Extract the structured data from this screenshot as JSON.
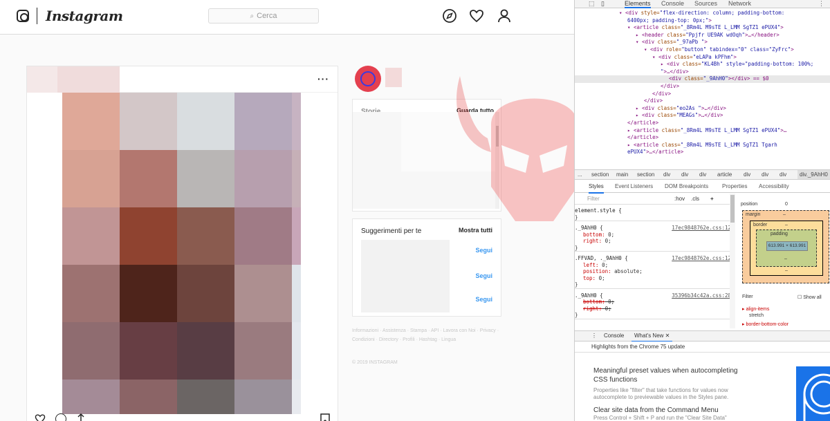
{
  "instagram": {
    "brand": "Instagram",
    "search_placeholder": "Cerca",
    "icons": [
      "instagram-logo-icon",
      "compass-icon",
      "heart-icon",
      "profile-icon",
      "more-icon",
      "like-icon",
      "comment-icon",
      "share-icon",
      "bookmark-icon"
    ],
    "sidebar": {
      "stories_title": "Storie",
      "stories_link": "Guarda tutto",
      "suggestions_title": "Suggerimenti per te",
      "suggestions_link": "Mostra tutti",
      "follow_labels": [
        "Segui",
        "Segui",
        "Segui"
      ]
    },
    "footer": {
      "links": "Informazioni · Assistenza · Stampa · API · Lavora con Noi · Privacy · Condizioni · Directory · Profili · Hashtag · Lingua",
      "copyright": "© 2019 INSTAGRAM"
    },
    "mosaic_colors": [
      "#dfa898",
      "#d3c7c8",
      "#d9dde0",
      "#b6a9bc",
      "#c7b3c2",
      "#d7a293",
      "#b3776f",
      "#b9b6b5",
      "#b79fae",
      "#c6b0b7",
      "#c19595",
      "#8f4330",
      "#8a5b4f",
      "#a07b86",
      "#c8a6b8",
      "#9d7271",
      "#4e241b",
      "#6d443d",
      "#ad8f90",
      "#dfe4ea",
      "#8f6c70",
      "#673e44",
      "#583d44",
      "#9a7b7f",
      "#e4e8ee",
      "#a48b97",
      "#8b6466",
      "#6b6564",
      "#9a919b",
      "#e8eaef"
    ],
    "accent_colors": {
      "avatar": "#e4404f",
      "follow": "#3897f0"
    }
  },
  "devtools": {
    "tabs": [
      "Elements",
      "Console",
      "Sources",
      "Network"
    ],
    "dom_lines": [
      {
        "indent": 64,
        "tag": "▾ <div ",
        "attr": "style",
        "val": "\"flex-direction: column; padding-bottom:",
        "rest": ""
      },
      {
        "indent": 76,
        "tag": "",
        "attr": "",
        "val": "6400px; padding-top: 0px;\"",
        "rest": ">"
      },
      {
        "indent": 76,
        "tag": "▾ <article ",
        "attr": "class",
        "val": "\"_8Rm4L M9sTE  L_LMM SgTZ1   ePUX4\"",
        "rest": ">"
      },
      {
        "indent": 88,
        "tag": "▸ <header ",
        "attr": "class",
        "val": "\"Ppjfr UE9AK  wdOqh\"",
        "rest": ">…</header>"
      },
      {
        "indent": 88,
        "tag": "▾ <div ",
        "attr": "class",
        "val": "\"_97aPb \"",
        "rest": ">"
      },
      {
        "indent": 100,
        "tag": "▾ <div ",
        "attr": "role",
        "val": "\"button\" tabindex=\"0\" class=\"ZyFrc\"",
        "rest": ">"
      },
      {
        "indent": 112,
        "tag": "▾ <div ",
        "attr": "class",
        "val": "\"eLAPa kPFhm\"",
        "rest": ">"
      },
      {
        "indent": 124,
        "tag": "▸ <div ",
        "attr": "class",
        "val": "\"KL4Bh\" style=\"padding-bottom: 100%;",
        "rest": ""
      },
      {
        "indent": 124,
        "tag": "",
        "attr": "",
        "val": "\"",
        "rest": ">…</div>"
      },
      {
        "indent": 136,
        "tag": "<div ",
        "attr": "class",
        "val": "\"_9AhH0\"",
        "rest": "></div> == $0"
      },
      {
        "indent": 124,
        "tag": "</div>",
        "attr": "",
        "val": "",
        "rest": ""
      },
      {
        "indent": 112,
        "tag": "</div>",
        "attr": "",
        "val": "",
        "rest": ""
      },
      {
        "indent": 100,
        "tag": "</div>",
        "attr": "",
        "val": "",
        "rest": ""
      },
      {
        "indent": 88,
        "tag": "▸ <div ",
        "attr": "class",
        "val": "\"eo2As \"",
        "rest": ">…</div>"
      },
      {
        "indent": 88,
        "tag": "▸ <div ",
        "attr": "class",
        "val": "\"MEAGs\"",
        "rest": ">…</div>"
      },
      {
        "indent": 76,
        "tag": "</article>",
        "attr": "",
        "val": "",
        "rest": ""
      },
      {
        "indent": 76,
        "tag": "▸ <article ",
        "attr": "class",
        "val": "\"_8Rm4L M9sTE  L_LMM SgTZ1   ePUX4\"",
        "rest": ">…"
      },
      {
        "indent": 76,
        "tag": "</article>",
        "attr": "",
        "val": "",
        "rest": ""
      },
      {
        "indent": 76,
        "tag": "▸ <article ",
        "attr": "class",
        "val": "\"_8Rm4L M9sTE  L_LMM SgTZ1   Tgarh",
        "rest": ""
      },
      {
        "indent": 76,
        "tag": "",
        "attr": "",
        "val": "ePUX4\"",
        "rest": ">…</article>"
      }
    ],
    "selected_dom_index": 9,
    "breadcrumbs": [
      "...",
      "section",
      "main",
      "section",
      "div",
      "div",
      "div",
      "article",
      "div",
      "div",
      "div",
      "div._9AhH0"
    ],
    "sub_tabs": [
      "Styles",
      "Event Listeners",
      "DOM Breakpoints",
      "Properties",
      "Accessibility"
    ],
    "styles_filter_placeholder": "Filter",
    "styles_filter_buttons": [
      ":hov",
      ".cls",
      "+"
    ],
    "style_rules": [
      {
        "selector": "element.style {",
        "source": "",
        "props": [
          "}"
        ]
      },
      {
        "selector": "._9AhH0 {",
        "source": "17ec9848762e.css:12",
        "props": [
          "bottom: 0;",
          "right: 0;",
          "}"
        ]
      },
      {
        "selector": ".FFVAD, ._9AhH0 {",
        "source": "17ec9848762e.css:12",
        "props": [
          "left: 0;",
          "position: absolute;",
          "top: 0;",
          "}"
        ]
      },
      {
        "selector": "._9AhH0 {",
        "source": "35396b34c42a.css:28",
        "props": [
          "bottom: 0;",
          "right: 0;",
          "}"
        ]
      }
    ],
    "box_model": {
      "position_label": "position",
      "position_value": "0",
      "margin_label": "margin",
      "border_label": "border",
      "padding_label": "padding",
      "content": "613.991 × 613.991",
      "dash": "–"
    },
    "computed_filter": "Filter",
    "show_all": "Show all",
    "computed_props": [
      "align-items",
      "stretch",
      "border-bottom-color"
    ],
    "console_tabs": [
      "Console",
      "What's New ✕"
    ],
    "whatsnew_header": "Highlights from the Chrome 75 update",
    "whatsnew_items": [
      {
        "title": "Meaningful preset values when autocompleting CSS functions",
        "desc": "Properties like \"filter\" that take functions for values now autocomplete to previewable values in the Styles pane."
      },
      {
        "title": "Clear site data from the Command Menu",
        "desc": "Press Control + Shift + P and run the \"Clear Site Data\""
      }
    ]
  }
}
